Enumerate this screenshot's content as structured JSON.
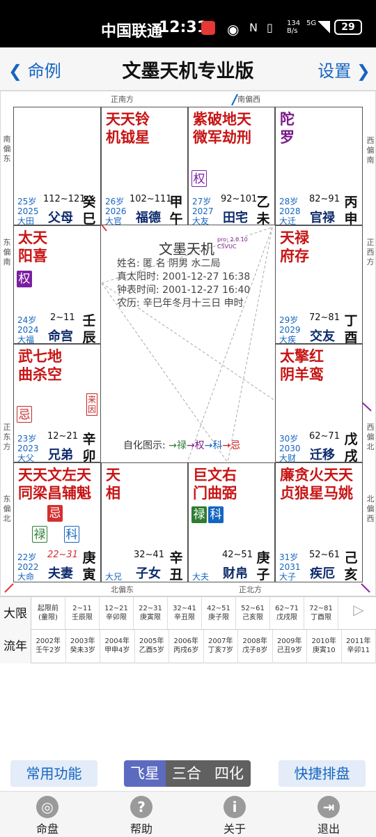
{
  "status_bar": {
    "carrier": "中国联通",
    "time": "12:31",
    "net_speed": "134 B/s",
    "net_type": "5G",
    "battery": "29"
  },
  "nav": {
    "back_label": "命例",
    "title": "文墨天机专业版",
    "settings_label": "设置"
  },
  "chart": {
    "directions": {
      "top_left": "正南方",
      "top_right": "南偏西",
      "left_top": "南偏东",
      "left_mid_upper": "东偏南",
      "left_mid_lower": "正东方",
      "left_bottom": "东偏北",
      "right_top": "西偏南",
      "right_mid_upper": "正西方",
      "right_mid_lower": "西偏北",
      "right_bottom": "北偏西",
      "bottom_left": "北偏东",
      "bottom_right": "正北方"
    },
    "palaces": {
      "si": {
        "stars_red": "",
        "stars_purple": "",
        "age": "25岁",
        "year": "2025",
        "range": "112~121",
        "palace": "父母",
        "gz1": "癸",
        "gz2": "巳",
        "dx": "大田"
      },
      "wu": {
        "stars_red": "天天铃",
        "stars_red2": "机钺星",
        "age": "26岁",
        "year": "2026",
        "range": "102~111",
        "palace": "福德",
        "gz1": "甲",
        "gz2": "午",
        "dx": "大官"
      },
      "wei": {
        "stars_red": "紫破地天",
        "stars_red2": "微军劫刑",
        "badge": "权",
        "age": "27岁",
        "year": "2027",
        "range": "92~101",
        "palace": "田宅",
        "gz1": "乙",
        "gz2": "未",
        "dx": "大友"
      },
      "shen": {
        "stars_purple": "陀",
        "stars_purple2": "罗",
        "age": "28岁",
        "year": "2028",
        "range": "82~91",
        "palace": "官禄",
        "gz1": "丙",
        "gz2": "申",
        "dx": "大迁"
      },
      "chen": {
        "stars_red": "太天",
        "stars_red2": "阳喜",
        "badge": "权",
        "age": "24岁",
        "year": "2024",
        "range": "2~11",
        "palace": "命宫",
        "gz1": "壬",
        "gz2": "辰",
        "dx": "大福"
      },
      "you": {
        "stars_red": "天禄",
        "stars_red2": "府存",
        "age": "29岁",
        "year": "2029",
        "range": "72~81",
        "palace": "交友",
        "gz1": "丁",
        "gz2": "酉",
        "dx": "大疾"
      },
      "mao": {
        "stars_red": "武七地",
        "stars_red2": "曲杀空",
        "badge": "忌",
        "laiyin": "来因",
        "age": "23岁",
        "year": "2023",
        "range": "12~21",
        "palace": "兄弟",
        "gz1": "辛",
        "gz2": "卯",
        "dx": "大父"
      },
      "xu": {
        "stars_red": "太擎红",
        "stars_red2": "阴羊鸾",
        "age": "30岁",
        "year": "2030",
        "range": "62~71",
        "palace": "迁移",
        "gz1": "戊",
        "gz2": "戌",
        "dx": "大财"
      },
      "yin": {
        "stars_red": "天天文左天",
        "stars_red2": "同梁昌辅魁",
        "badge_ji": "忌",
        "badge_lu": "禄",
        "badge_ke": "科",
        "age": "22岁",
        "year": "2022",
        "range": "22~31",
        "palace": "夫妻",
        "gz1": "庚",
        "gz2": "寅",
        "dx": "大命"
      },
      "chou": {
        "stars_red": "天",
        "stars_red2": "相",
        "range": "32~41",
        "palace": "子女",
        "gz1": "辛",
        "gz2": "丑",
        "dx": "大兄"
      },
      "zi": {
        "stars_red": "巨文右",
        "stars_red2": "门曲弼",
        "badge_lu": "禄",
        "badge_ke": "科",
        "range": "42~51",
        "palace": "财帛",
        "gz1": "庚",
        "gz2": "子",
        "dx": "大夫"
      },
      "hai": {
        "stars_red": "廉贪火天天",
        "stars_red2": "贞狼星马姚",
        "age": "31岁",
        "year": "2031",
        "range": "52~61",
        "palace": "疾厄",
        "gz1": "己",
        "gz2": "亥",
        "dx": "大子"
      }
    },
    "center": {
      "title": "文墨天机",
      "version": "pro: 2.0.10",
      "code": "C5VUC",
      "name_line": "姓名: 匿 名          阴男 水二局",
      "solar_line": "真太阳时: 2001-12-27 16:38",
      "clock_line": "钟表时间: 2001-12-27 16:40",
      "lunar_line": "农历: 辛巳年冬月十三日 申时",
      "sihua_label": "自化图示:",
      "sihua_items": [
        "→禄",
        "→权",
        "→科",
        "→忌"
      ]
    }
  },
  "table": {
    "daxian_label": "大限",
    "liunian_label": "流年",
    "daxian": [
      [
        "起限前",
        "(童限)"
      ],
      [
        "2~11",
        "壬辰限"
      ],
      [
        "12~21",
        "辛卯限"
      ],
      [
        "22~31",
        "庚寅限"
      ],
      [
        "32~41",
        "辛丑限"
      ],
      [
        "42~51",
        "庚子限"
      ],
      [
        "52~61",
        "己亥限"
      ],
      [
        "62~71",
        "戊戌限"
      ],
      [
        "72~81",
        "丁酉限"
      ]
    ],
    "liunian": [
      [
        "2002年",
        "壬午2岁"
      ],
      [
        "2003年",
        "癸未3岁"
      ],
      [
        "2004年",
        "甲申4岁"
      ],
      [
        "2005年",
        "乙酉5岁"
      ],
      [
        "2006年",
        "丙戌6岁"
      ],
      [
        "2007年",
        "丁亥7岁"
      ],
      [
        "2008年",
        "戊子8岁"
      ],
      [
        "2009年",
        "己丑9岁"
      ],
      [
        "2010年",
        "庚寅10"
      ],
      [
        "2011年",
        "辛卯11"
      ]
    ]
  },
  "toolbar": {
    "common": "常用功能",
    "seg_feixing": "飞星",
    "seg_sanhe": "三合",
    "seg_sihua": "四化",
    "quick": "快捷排盘"
  },
  "tabs": [
    {
      "label": "命盘"
    },
    {
      "label": "帮助"
    },
    {
      "label": "关于"
    },
    {
      "label": "退出"
    }
  ]
}
